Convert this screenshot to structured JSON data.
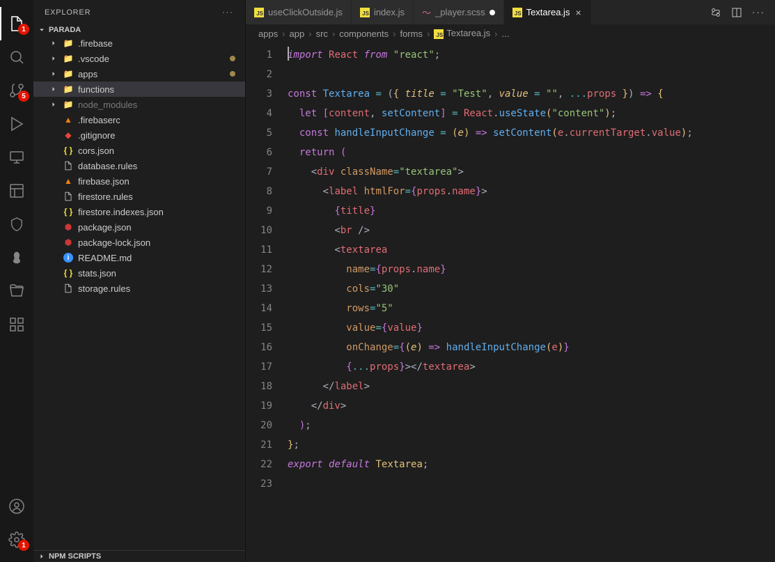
{
  "sidebar": {
    "title": "EXPLORER",
    "project": "PARADA",
    "npm_section": "NPM SCRIPTS",
    "tree": [
      {
        "type": "folder",
        "name": ".firebase",
        "icon": "folder",
        "indent": 1,
        "expandable": true,
        "open": false
      },
      {
        "type": "folder",
        "name": ".vscode",
        "icon": "folder-blue",
        "indent": 1,
        "expandable": true,
        "open": false,
        "modified": true
      },
      {
        "type": "folder",
        "name": "apps",
        "icon": "folder-red",
        "indent": 1,
        "expandable": true,
        "open": false,
        "modified": true
      },
      {
        "type": "folder",
        "name": "functions",
        "icon": "folder-blue",
        "indent": 1,
        "expandable": true,
        "open": false,
        "selected": true
      },
      {
        "type": "folder",
        "name": "node_modules",
        "icon": "folder",
        "indent": 1,
        "expandable": true,
        "open": false,
        "dim": true
      },
      {
        "type": "file",
        "name": ".firebaserc",
        "icon": "firebase",
        "indent": 1
      },
      {
        "type": "file",
        "name": ".gitignore",
        "icon": "git",
        "indent": 1
      },
      {
        "type": "file",
        "name": "cors.json",
        "icon": "json",
        "indent": 1
      },
      {
        "type": "file",
        "name": "database.rules",
        "icon": "file",
        "indent": 1
      },
      {
        "type": "file",
        "name": "firebase.json",
        "icon": "firebase",
        "indent": 1
      },
      {
        "type": "file",
        "name": "firestore.rules",
        "icon": "file",
        "indent": 1
      },
      {
        "type": "file",
        "name": "firestore.indexes.json",
        "icon": "json",
        "indent": 1
      },
      {
        "type": "file",
        "name": "package.json",
        "icon": "npm",
        "indent": 1
      },
      {
        "type": "file",
        "name": "package-lock.json",
        "icon": "npm",
        "indent": 1
      },
      {
        "type": "file",
        "name": "README.md",
        "icon": "info",
        "indent": 1
      },
      {
        "type": "file",
        "name": "stats.json",
        "icon": "json",
        "indent": 1
      },
      {
        "type": "file",
        "name": "storage.rules",
        "icon": "file",
        "indent": 1
      }
    ]
  },
  "activity": {
    "explorer_badge": "1",
    "scm_badge": "5",
    "settings_badge": "1"
  },
  "tabs": [
    {
      "label": "useClickOutside.js",
      "icon": "js",
      "active": false,
      "unsaved": false
    },
    {
      "label": "index.js",
      "icon": "js",
      "active": false,
      "unsaved": false
    },
    {
      "label": "_player.scss",
      "icon": "scss",
      "active": false,
      "unsaved": true
    },
    {
      "label": "Textarea.js",
      "icon": "js",
      "active": true,
      "unsaved": false
    }
  ],
  "breadcrumbs": [
    "apps",
    "app",
    "src",
    "components",
    "forms",
    "Textarea.js",
    "..."
  ],
  "code": {
    "lines": 23
  }
}
